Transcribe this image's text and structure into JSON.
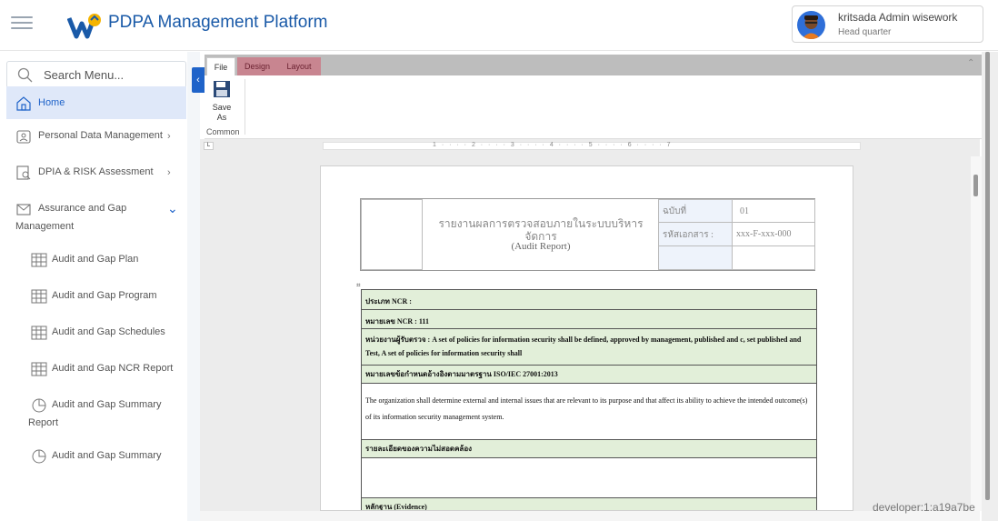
{
  "header": {
    "title": "PDPA Management Platform",
    "user_name": "kritsada Admin wisework",
    "user_org": "Head quarter"
  },
  "sidebar": {
    "search_placeholder": "Search Menu...",
    "items": [
      {
        "label": "Home"
      },
      {
        "label": "Personal Data Management",
        "chevron": "›"
      },
      {
        "label": "DPIA & RISK Assessment",
        "chevron": "›"
      },
      {
        "label": "Assurance and Gap",
        "label2": "Management",
        "chevron": "⌄"
      }
    ],
    "subitems": [
      {
        "label": "Audit and Gap Plan"
      },
      {
        "label": "Audit and Gap Program"
      },
      {
        "label": "Audit and Gap Schedules"
      },
      {
        "label": "Audit and Gap NCR Report"
      },
      {
        "label": "Audit and Gap Summary",
        "label2": "Report"
      },
      {
        "label": "Audit and Gap Summary"
      }
    ]
  },
  "ribbon": {
    "tabs": [
      "File",
      "Design",
      "Layout"
    ],
    "save_as": "Save\nAs",
    "group": "Common"
  },
  "ruler": {
    "marks": "1 · · · · 2 · · · · 3 · · · · 4 · · · · 5 · · · · 6 · · · · 7"
  },
  "document": {
    "title_th": "รายงานผลการตรวจสอบภายในระบบบริหารจัดการ",
    "title_en": "(Audit Report)",
    "version_label": "ฉบับที่",
    "version_value": "01",
    "docno_label": "รหัสเอกสาร :",
    "docno_value": "xxx-F-xxx-000",
    "rows": [
      "ประเภท NCR :",
      "หมายเลข NCR : 111",
      "หน่วยงานผู้รับตรวจ :  A set of policies for information security shall be defined, approved by management, published and c, set published and Test, A set of policies for information security shall",
      "หมายเลขข้อกำหนดอ้างอิงตามมาตรฐาน ISO/IEC 27001:2013",
      "The organization shall determine external and internal issues that are relevant to its purpose and that affect its ability to achieve the intended outcome(s) of its information security management system.",
      "รายละเอียดของความไม่สอดคล้อง",
      "",
      "หลักฐาน (Evidence)"
    ]
  },
  "watermark": "developer:1:a19a7be"
}
